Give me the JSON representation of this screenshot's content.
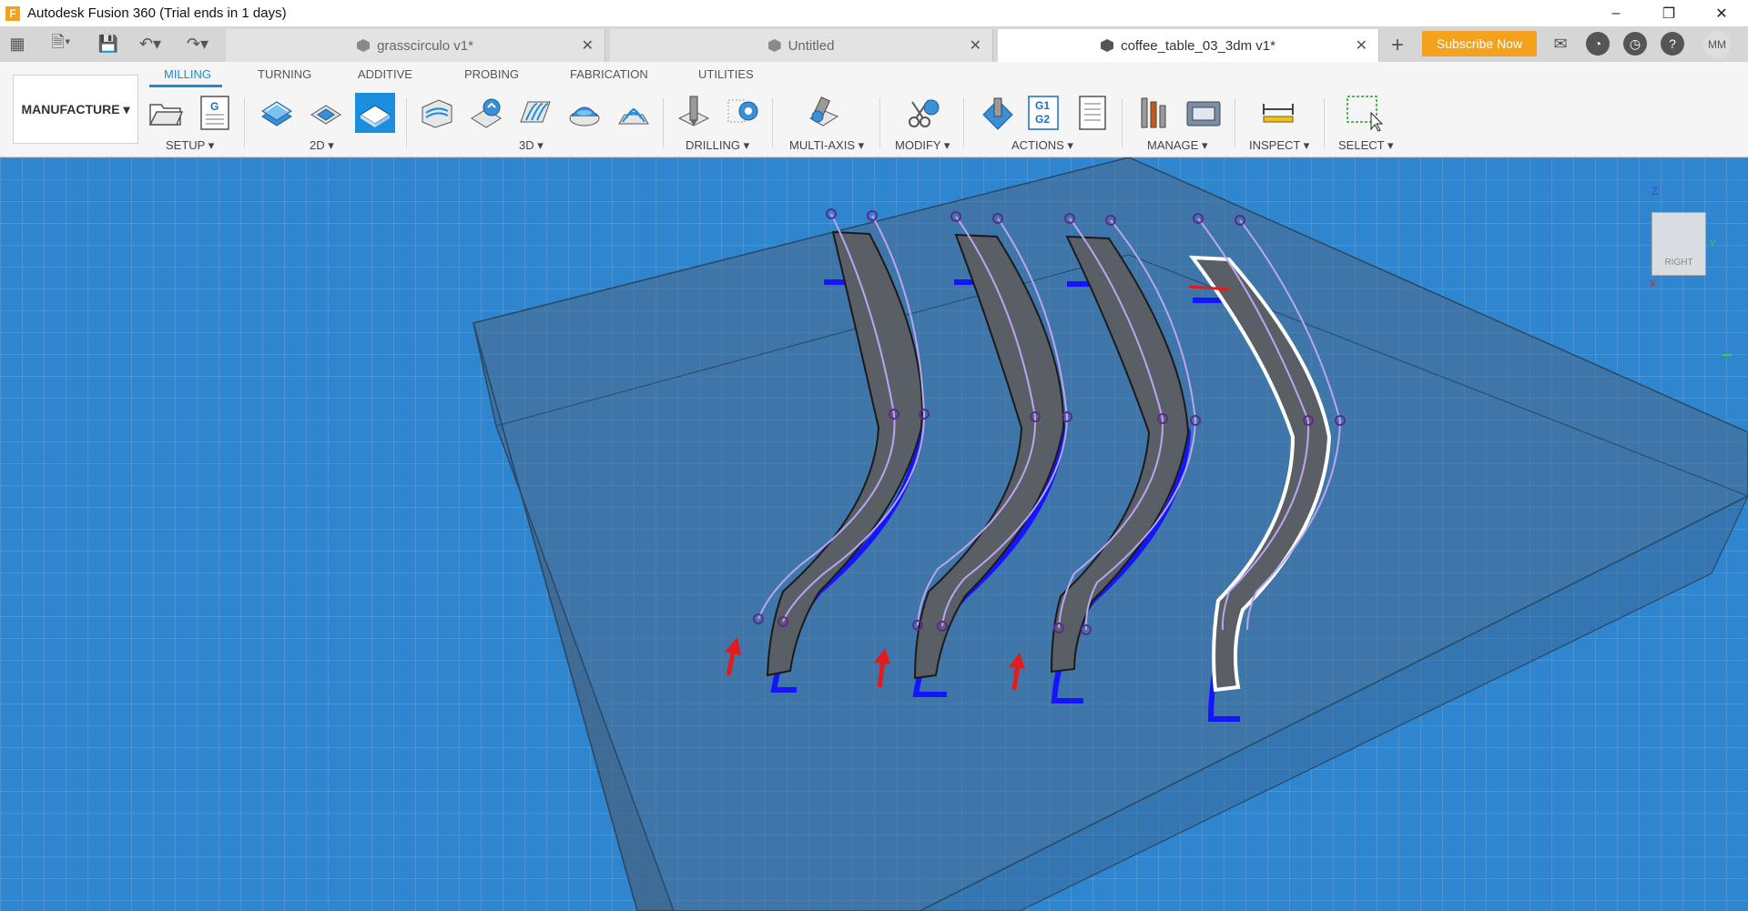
{
  "app": {
    "title": "Autodesk Fusion 360 (Trial ends in 1 days)",
    "logo_letter": "F"
  },
  "window_controls": {
    "minimize": "–",
    "restore": "❐",
    "close": "✕"
  },
  "quick_access": {
    "grid": "▦",
    "file": "🗎▾",
    "save": "💾",
    "undo": "↶▾",
    "redo": "↷▾"
  },
  "tabs": [
    {
      "label": "grasscirculo v1*",
      "close": "✕"
    },
    {
      "label": "Untitled",
      "close": "✕"
    },
    {
      "label": "coffee_table_03_3dm v1*",
      "close": "✕"
    }
  ],
  "header_actions": {
    "new_tab": "+",
    "subscribe": "Subscribe Now",
    "avatar": "MM",
    "notifications_icon": "✉",
    "jobs_icon": "◔",
    "history_icon": "◷",
    "help_icon": "?"
  },
  "workspace": {
    "label": "MANUFACTURE ▾"
  },
  "ribbon_tabs": [
    "MILLING",
    "TURNING",
    "ADDITIVE",
    "PROBING",
    "FABRICATION",
    "UTILITIES"
  ],
  "active_ribbon_tab": "MILLING",
  "groups": {
    "setup": "SETUP ▾",
    "two_d": "2D ▾",
    "three_d": "3D ▾",
    "drilling": "DRILLING ▾",
    "multi_axis": "MULTI-AXIS ▾",
    "modify": "MODIFY ▾",
    "actions": "ACTIONS ▾",
    "manage": "MANAGE ▾",
    "inspect": "INSPECT ▾",
    "select": "SELECT ▾"
  },
  "tool_text": {
    "nc_program": "G",
    "post_g1": "G1",
    "post_g2": "G2"
  },
  "viewcube": {
    "face": "RIGHT",
    "z_axis": "Z",
    "x_axis": "X",
    "y_axis": "Y"
  },
  "colors": {
    "accent": "#1b8fde",
    "subscribe": "#f4a21d",
    "viewport": "#2f86cf",
    "toolpath": "#1414ff",
    "sketch": "#b9a6f0",
    "arrow": "#e31b1b"
  }
}
